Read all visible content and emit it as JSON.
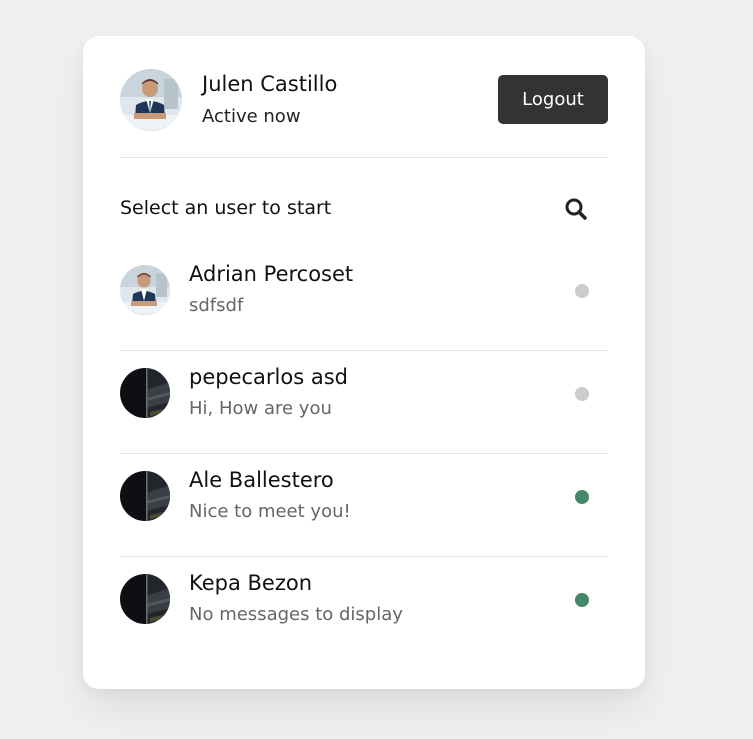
{
  "header": {
    "name": "Julen Castillo",
    "status": "Active now",
    "logout_label": "Logout",
    "avatar_icon": "business-person-photo"
  },
  "search": {
    "label": "Select an user to start",
    "icon": "search-icon"
  },
  "colors": {
    "online": "#468669",
    "offline": "#cccccc",
    "logout_bg": "#333333"
  },
  "users": [
    {
      "name": "Adrian Percoset",
      "message": "sdfsdf",
      "status": "offline",
      "avatar": "business-person-photo"
    },
    {
      "name": "pepecarlos asd",
      "message": "Hi, How are you",
      "status": "offline",
      "avatar": "dark-photo"
    },
    {
      "name": "Ale Ballestero",
      "message": "Nice to meet you!",
      "status": "online",
      "avatar": "dark-photo"
    },
    {
      "name": "Kepa Bezon",
      "message": "No messages to display",
      "status": "online",
      "avatar": "dark-photo"
    }
  ]
}
